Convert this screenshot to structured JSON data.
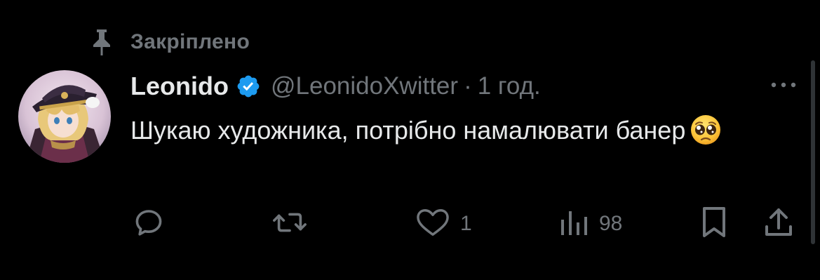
{
  "pinned": {
    "label": "Закріплено",
    "icon": "pin-icon"
  },
  "tweet": {
    "author": {
      "display_name": "Leonido",
      "handle": "@LeonidoXwitter",
      "verified": true,
      "avatar": "avatar"
    },
    "separator": "·",
    "time": "1 год.",
    "text": "Шукаю художника, потрібно намалювати банер",
    "emoji": "pleading-face",
    "more_icon": "more-horizontal-icon"
  },
  "actions": {
    "reply": {
      "icon": "reply-icon",
      "count": ""
    },
    "retweet": {
      "icon": "retweet-icon",
      "count": ""
    },
    "like": {
      "icon": "heart-icon",
      "count": "1"
    },
    "views": {
      "icon": "views-icon",
      "count": "98"
    },
    "bookmark": {
      "icon": "bookmark-icon",
      "count": ""
    },
    "share": {
      "icon": "share-icon",
      "count": ""
    }
  },
  "colors": {
    "background": "#000000",
    "text_primary": "#e7e9ea",
    "text_secondary": "#71767b",
    "verified_blue": "#1d9bf0"
  }
}
